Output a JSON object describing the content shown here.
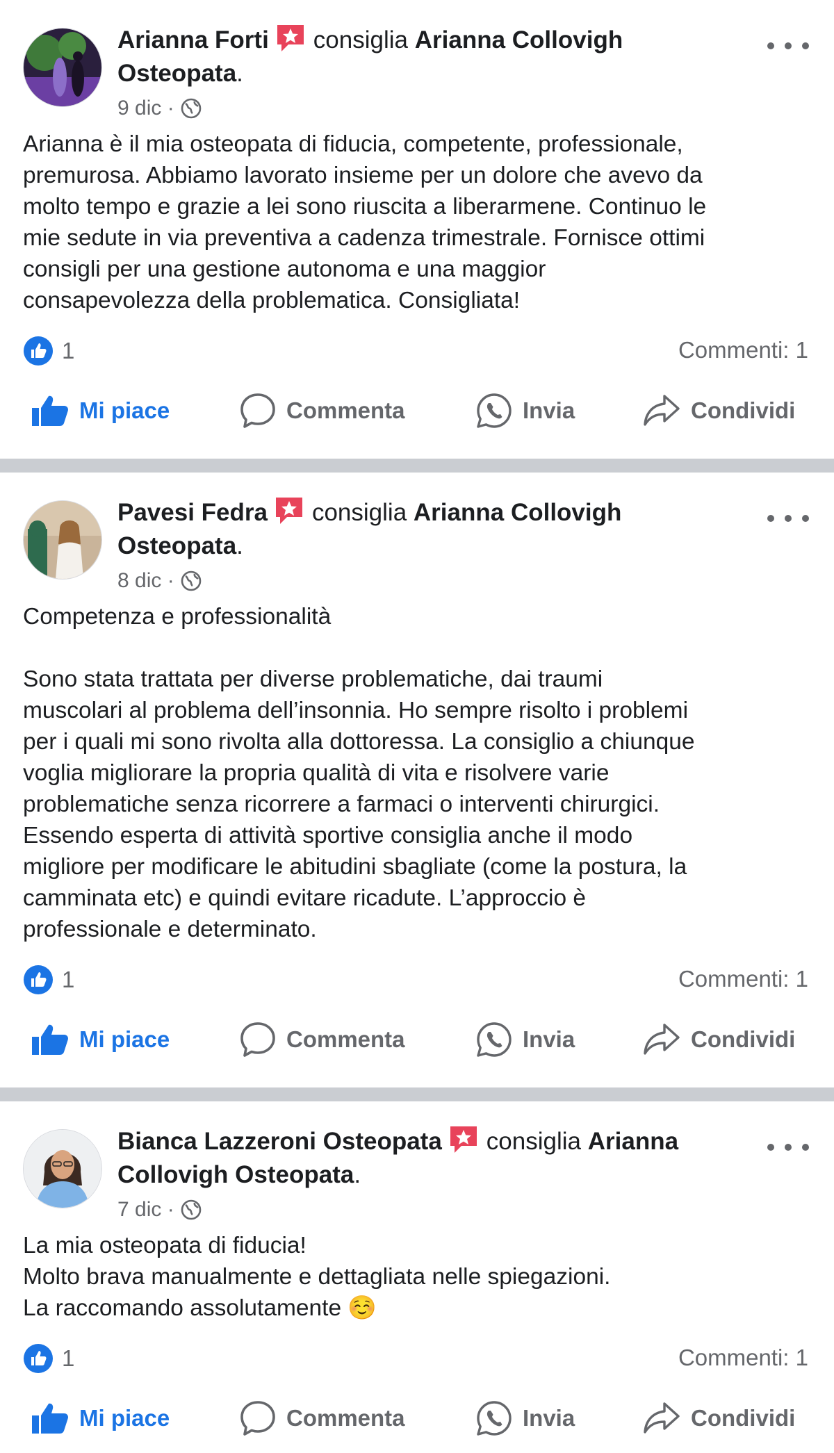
{
  "posts": [
    {
      "author": "Arianna Forti",
      "verb": "consiglia",
      "target": "Arianna Collovigh Osteopata",
      "date": "9 dic",
      "body": "Arianna è il mia osteopata di fiducia, competente, professionale,\npremurosa. Abbiamo lavorato insieme per un dolore che avevo da\nmolto tempo e grazie a lei sono riuscita a liberarmene. Continuo le\nmie sedute in via preventiva a cadenza trimestrale. Fornisce ottimi\nconsigli per una gestione autonoma e una maggior\nconsapevolezza della problematica. Consigliata!",
      "likes": "1",
      "comments": "Commenti: 1"
    },
    {
      "author": "Pavesi Fedra",
      "verb": "consiglia",
      "target": "Arianna Collovigh Osteopata",
      "date": "8 dic",
      "body": "Competenza e professionalità\n\nSono stata trattata per diverse problematiche, dai traumi\nmuscolari al problema dell’insonnia. Ho sempre risolto i problemi\nper i quali mi sono rivolta alla dottoressa. La consiglio a chiunque\nvoglia migliorare la propria qualità di vita e risolvere varie\nproblematiche senza ricorrere a farmaci o interventi chirurgici.\nEssendo esperta di attività sportive consiglia anche il modo\nmigliore per modificare le abitudini sbagliate (come la postura, la\ncamminata etc) e quindi evitare ricadute. L’approccio è\nprofessionale e determinato.",
      "likes": "1",
      "comments": "Commenti: 1"
    },
    {
      "author": "Bianca Lazzeroni  Osteopata",
      "verb": "consiglia",
      "target": "Arianna Collovigh Osteopata",
      "date": "7 dic",
      "body": "La mia osteopata di fiducia!\nMolto brava manualmente e dettagliata nelle spiegazioni.\nLa raccomando assolutamente ☺️",
      "likes": "1",
      "comments": "Commenti: 1"
    }
  ],
  "actions": {
    "like": "Mi piace",
    "comment": "Commenta",
    "send": "Invia",
    "share": "Condividi"
  },
  "icons": {
    "recommend_badge": "recommend-star-flag-icon",
    "audience": "globe-icon",
    "like_bubble": "thumbs-up-bubble-icon",
    "more": "more-dots-icon",
    "like": "thumbs-up-icon",
    "comment": "speech-bubble-icon",
    "send": "whatsapp-icon",
    "share": "share-arrow-icon"
  },
  "colors": {
    "accent_blue": "#1b74e4",
    "badge_red": "#e8435a",
    "secondary_text": "#65676b",
    "divider": "#cacdd2"
  },
  "meta_separator": "·",
  "target_suffix": "."
}
